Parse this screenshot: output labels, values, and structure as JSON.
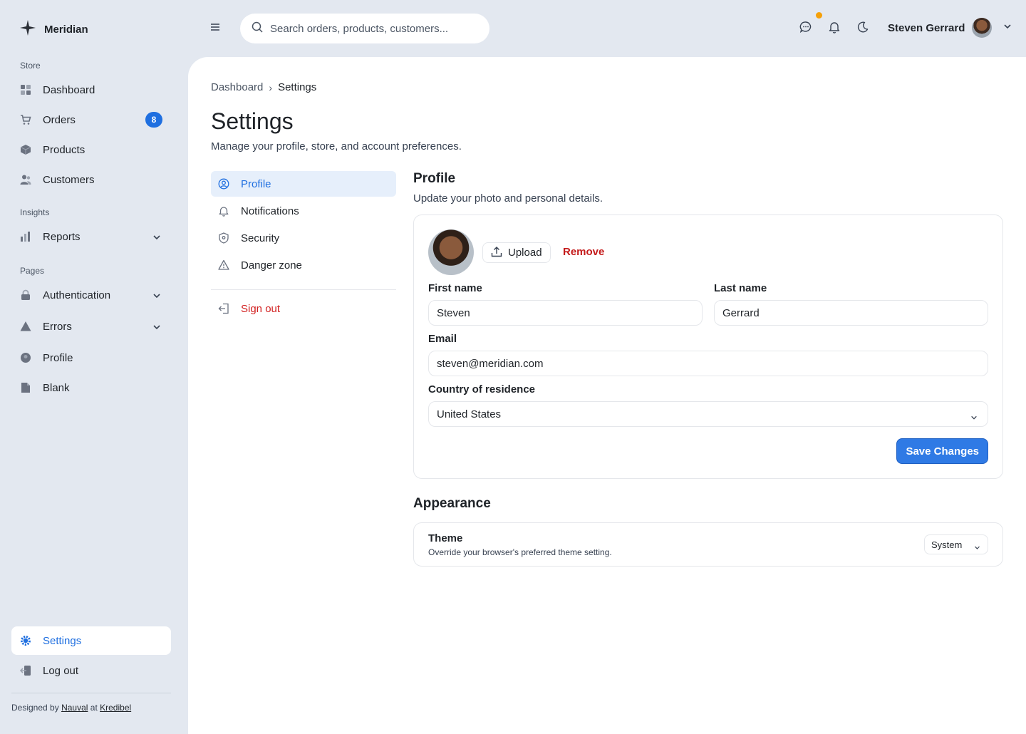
{
  "brand": {
    "name": "Meridian"
  },
  "sidebar": {
    "sections": {
      "store": "Store",
      "insights": "Insights",
      "pages": "Pages"
    },
    "items": {
      "dashboard": "Dashboard",
      "orders": "Orders",
      "orders_badge": "8",
      "products": "Products",
      "customers": "Customers",
      "reports": "Reports",
      "authentication": "Authentication",
      "errors": "Errors",
      "profile": "Profile",
      "blank": "Blank",
      "settings": "Settings",
      "logout": "Log out"
    },
    "credits": {
      "prefix": "Designed by",
      "author": "Nauval",
      "middle": "at",
      "company": "Kredibel"
    }
  },
  "topbar": {
    "search_placeholder": "Search orders, products, customers...",
    "user_name": "Steven Gerrard"
  },
  "breadcrumb": {
    "parent": "Dashboard",
    "separator": "›",
    "current": "Settings"
  },
  "page": {
    "title": "Settings",
    "subtitle": "Manage your profile, store, and account preferences."
  },
  "settings_nav": {
    "profile": "Profile",
    "notifications": "Notifications",
    "security": "Security",
    "danger_zone": "Danger zone",
    "sign_out": "Sign out"
  },
  "profile": {
    "title": "Profile",
    "subtitle": "Update your photo and personal details.",
    "upload_label": "Upload",
    "remove_label": "Remove",
    "first_name_label": "First name",
    "first_name_value": "Steven",
    "last_name_label": "Last name",
    "last_name_value": "Gerrard",
    "email_label": "Email",
    "email_value": "steven@meridian.com",
    "country_label": "Country of residence",
    "country_value": "United States",
    "save_label": "Save Changes"
  },
  "appearance": {
    "title": "Appearance",
    "theme_title": "Theme",
    "theme_desc": "Override your browser's preferred theme setting.",
    "theme_value": "System"
  },
  "colors": {
    "accent": "#1f6fe0",
    "danger": "#d21f1f",
    "notification_dot": "#f5a009"
  }
}
